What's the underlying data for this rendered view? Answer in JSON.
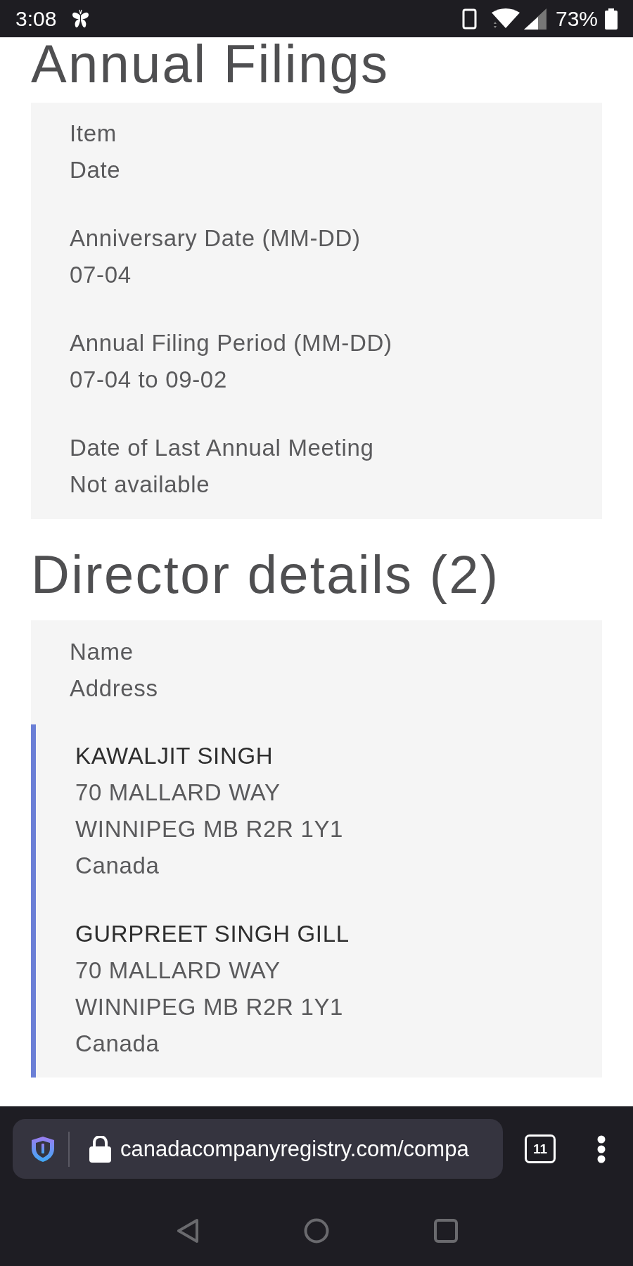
{
  "status_bar": {
    "time": "3:08",
    "battery": "73%"
  },
  "annual_filings": {
    "title": "Annual Filings",
    "columns": [
      "Item",
      "Date"
    ],
    "rows": [
      {
        "item": "Anniversary Date (MM-DD)",
        "date": "07-04"
      },
      {
        "item": "Annual Filing Period (MM-DD)",
        "date": "07-04 to 09-02"
      },
      {
        "item": "Date of Last Annual Meeting",
        "date": "Not available"
      }
    ]
  },
  "director_details": {
    "title": "Director details (2)",
    "columns": [
      "Name",
      "Address"
    ],
    "directors": [
      {
        "name": "KAWALJIT SINGH",
        "address": [
          "70 MALLARD WAY",
          "WINNIPEG MB R2R 1Y1",
          "Canada"
        ]
      },
      {
        "name": "GURPREET SINGH GILL",
        "address": [
          "70 MALLARD WAY",
          "WINNIPEG MB R2R 1Y1",
          "Canada"
        ]
      }
    ]
  },
  "browser": {
    "url": "canadacompanyregistry.com/compa",
    "tab_count": "11"
  }
}
